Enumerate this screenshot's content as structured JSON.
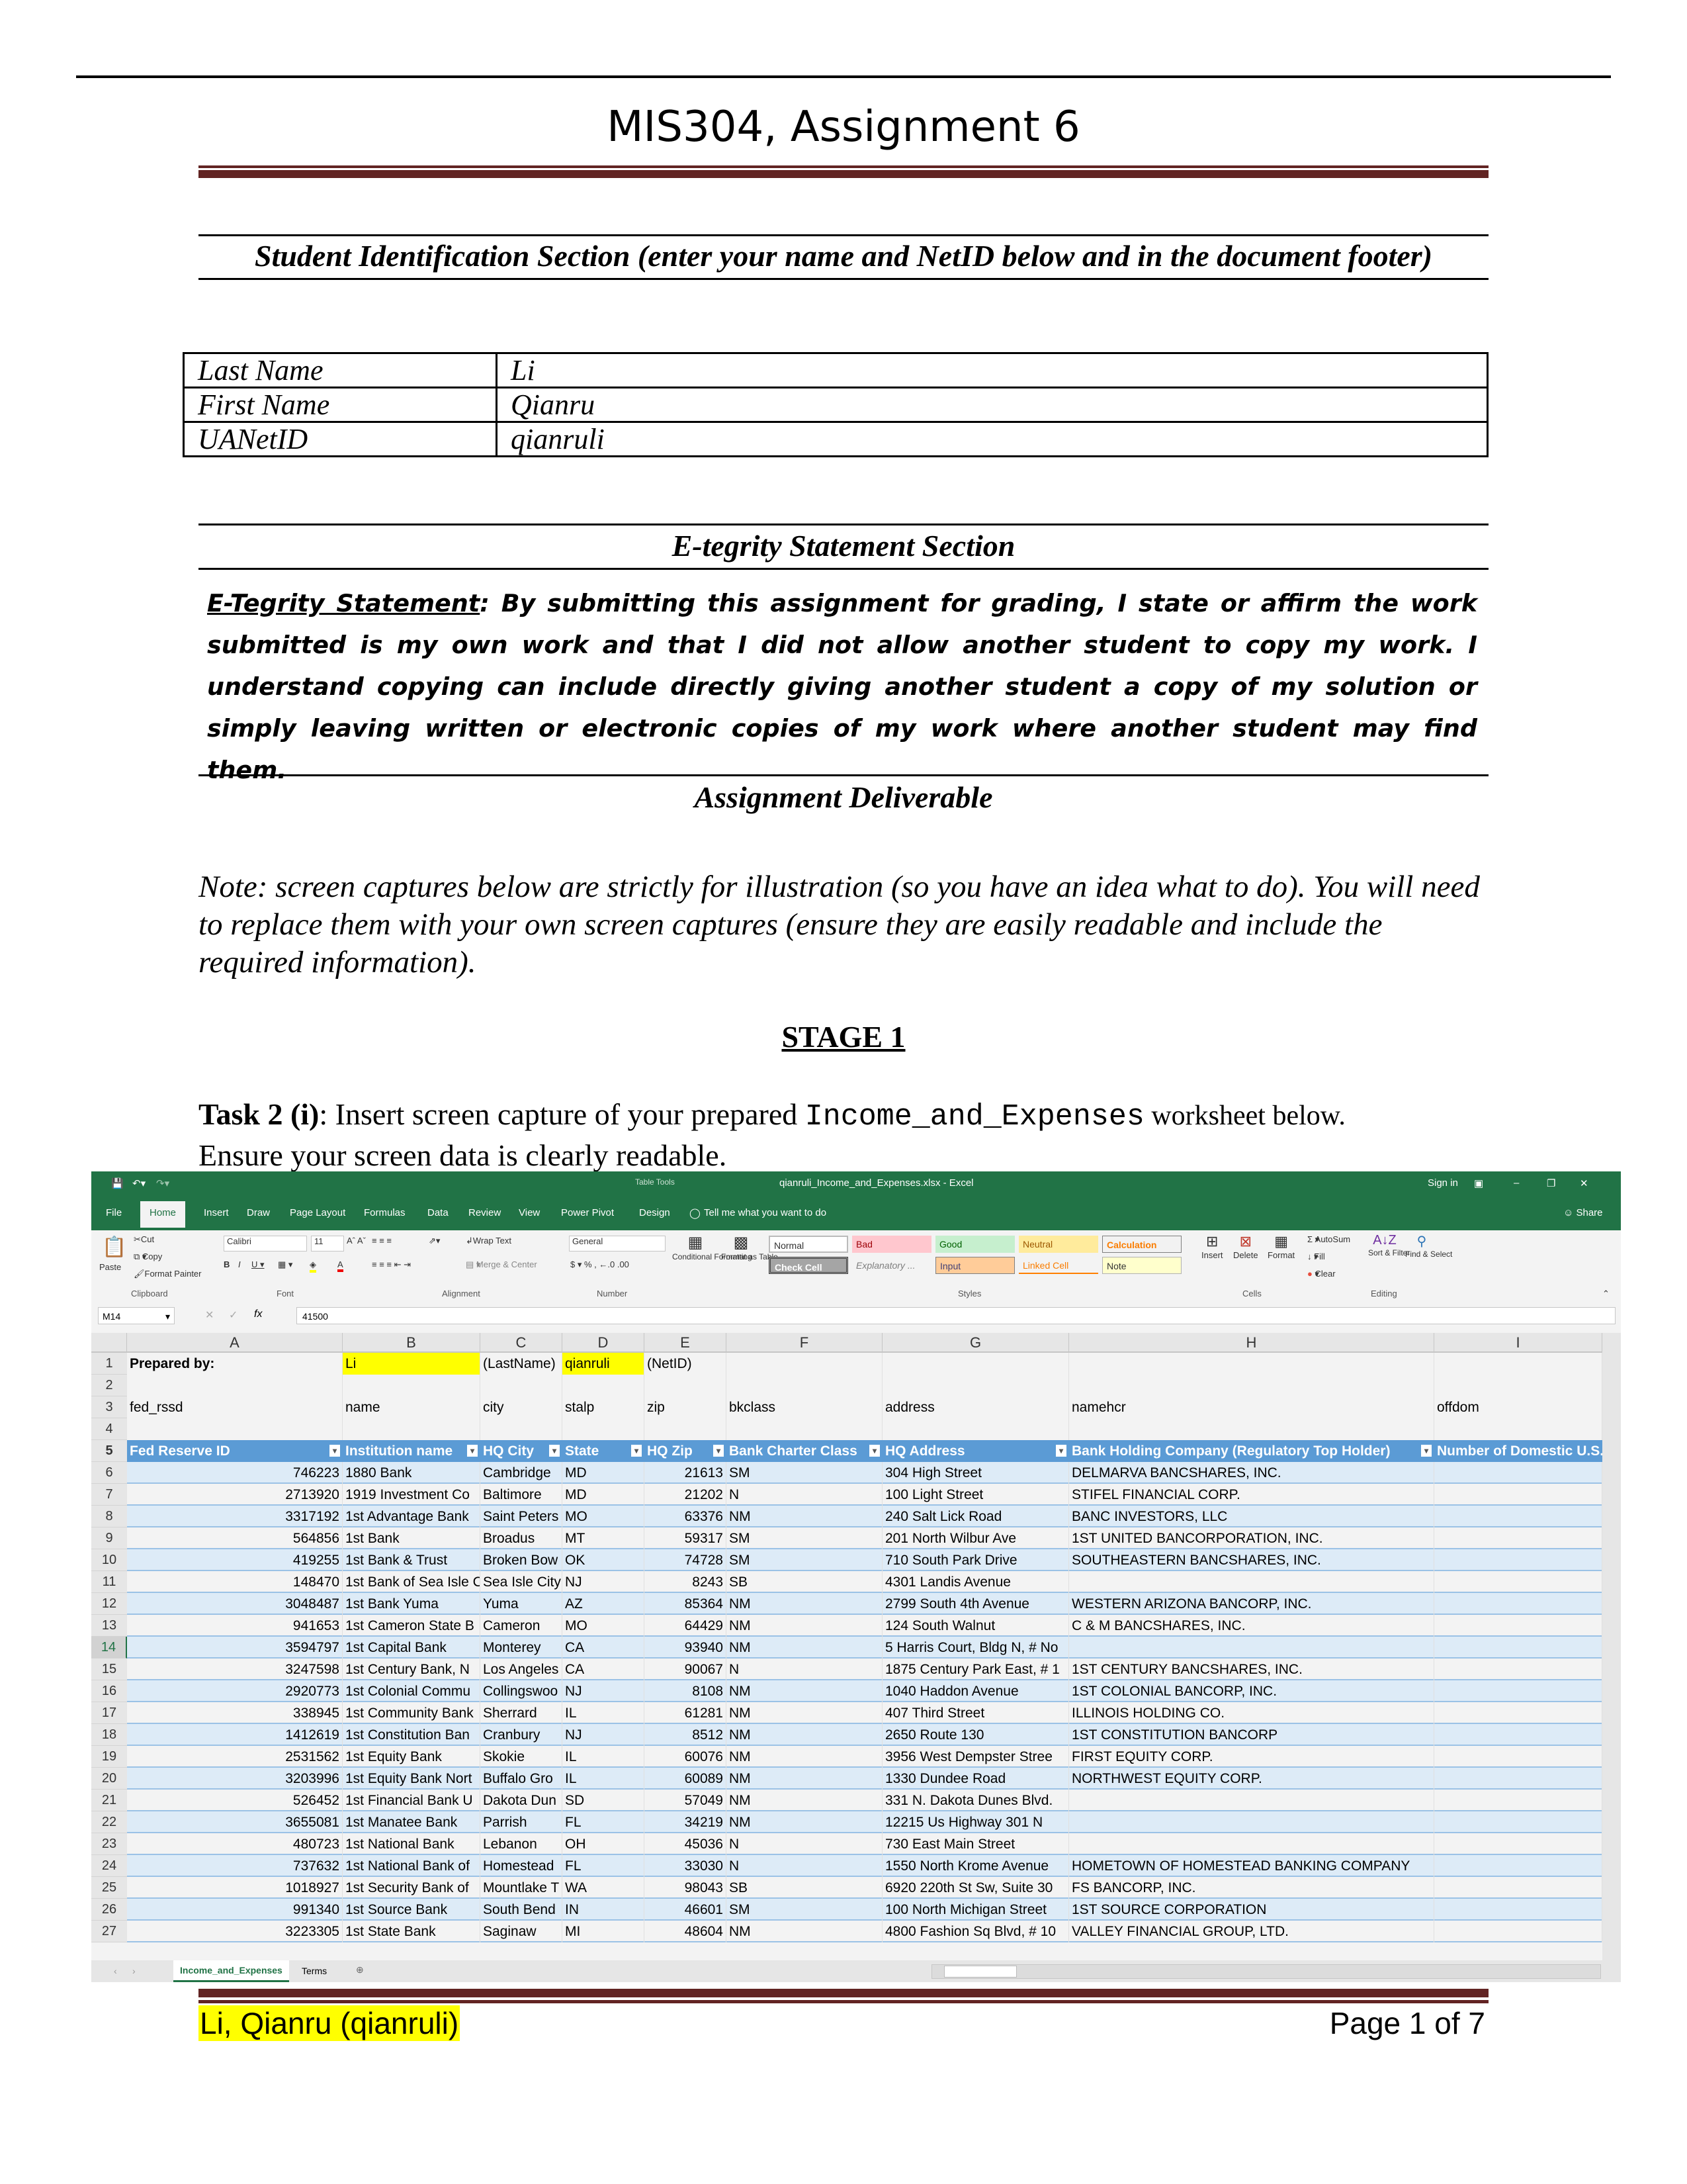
{
  "document": {
    "title": "MIS304, Assignment 6",
    "student_section_heading": "Student Identification Section (enter your name and NetID below and in the document footer)",
    "student_info": [
      {
        "label": "Last Name",
        "value": "Li"
      },
      {
        "label": "First Name",
        "value": "Qianru"
      },
      {
        "label": "UANetID",
        "value": "qianruli"
      }
    ],
    "etegrity_heading": "E-tegrity Statement Section",
    "etegrity_label": "E-Tegrity Statement",
    "etegrity_text": ":   By submitting this assignment for grading, I state or affirm the work submitted is my own work and that I did not allow another student to copy my work.  I understand copying can include directly giving another student a copy of my solution or simply leaving written or electronic copies of my work where another student may find them.",
    "deliverable_heading": "Assignment Deliverable",
    "note": "Note: screen captures below are strictly for illustration (so you have an idea what to do). You will need to replace them with your own screen captures (ensure they are easily readable and include the required information).",
    "stage": "STAGE 1",
    "task_label": "Task 2 (i)",
    "task_text_1": ": Insert screen capture of your prepared ",
    "task_worksheet": "Income_and_Expenses",
    "task_text_2": " worksheet below.",
    "task_text_3": "Ensure your screen data is clearly readable.",
    "footer_left": "Li, Qianru (qianruli)",
    "footer_right": "Page 1 of 7"
  },
  "excel": {
    "window_title": "qianruli_Income_and_Expenses.xlsx - Excel",
    "table_tools": "Table Tools",
    "sign_in": "Sign in",
    "share": "Share",
    "tabs": [
      "File",
      "Home",
      "Insert",
      "Draw",
      "Page Layout",
      "Formulas",
      "Data",
      "Review",
      "View",
      "Power Pivot",
      "Design"
    ],
    "tell_me": "Tell me what you want to do",
    "ribbon": {
      "clipboard": {
        "paste": "Paste",
        "cut": "Cut",
        "copy": "Copy",
        "format_painter": "Format Painter",
        "label": "Clipboard"
      },
      "font": {
        "name": "Calibri",
        "size": "11",
        "label": "Font"
      },
      "alignment": {
        "wrap": "Wrap Text",
        "merge": "Merge & Center",
        "label": "Alignment"
      },
      "number": {
        "format": "General",
        "label": "Number"
      },
      "styles": {
        "cond": "Conditional Formatting",
        "format_table": "Format as Table",
        "label": "Styles",
        "items": [
          "Normal",
          "Bad",
          "Good",
          "Neutral",
          "Calculation",
          "Check Cell",
          "Explanatory ...",
          "Input",
          "Linked Cell",
          "Note"
        ]
      },
      "cells": {
        "insert": "Insert",
        "delete": "Delete",
        "format": "Format",
        "label": "Cells"
      },
      "editing": {
        "autosum": "AutoSum",
        "fill": "Fill",
        "clear": "Clear",
        "sort": "Sort & Filter",
        "find": "Find & Select",
        "label": "Editing"
      }
    },
    "name_box": "M14",
    "formula": "41500",
    "columns": [
      "A",
      "B",
      "C",
      "D",
      "E",
      "F",
      "G",
      "H",
      "I"
    ],
    "row1": [
      "Prepared by:",
      "Li",
      "(LastName)",
      "qianruli",
      "(NetID)",
      "",
      "",
      "",
      ""
    ],
    "row3": [
      "fed_rssd",
      "name",
      "city",
      "stalp",
      "zip",
      "bkclass",
      "address",
      "namehcr",
      "offdom"
    ],
    "headers": [
      "Fed Reserve ID",
      "Institution name",
      "HQ City",
      "State",
      "HQ Zip",
      "Bank Charter Class",
      "HQ Address",
      "Bank Holding Company (Regulatory Top Holder)",
      "Number of Domestic U.S."
    ],
    "rows": [
      [
        "746223",
        "1880 Bank",
        "Cambridge",
        "MD",
        "21613",
        "SM",
        "304 High Street",
        "DELMARVA BANCSHARES, INC."
      ],
      [
        "2713920",
        "1919 Investment Co",
        "Baltimore",
        "MD",
        "21202",
        "N",
        "100 Light Street",
        "STIFEL FINANCIAL CORP."
      ],
      [
        "3317192",
        "1st Advantage Bank",
        "Saint Peters",
        "MO",
        "63376",
        "NM",
        "240 Salt Lick Road",
        "BANC INVESTORS, LLC"
      ],
      [
        "564856",
        "1st Bank",
        "Broadus",
        "MT",
        "59317",
        "SM",
        "201 North Wilbur Ave",
        "1ST UNITED BANCORPORATION, INC."
      ],
      [
        "419255",
        "1st Bank & Trust",
        "Broken Bow",
        "OK",
        "74728",
        "SM",
        "710 South Park Drive",
        "SOUTHEASTERN BANCSHARES, INC."
      ],
      [
        "148470",
        "1st Bank of Sea Isle C",
        "Sea Isle City",
        "NJ",
        "8243",
        "SB",
        "4301 Landis Avenue",
        ""
      ],
      [
        "3048487",
        "1st Bank Yuma",
        "Yuma",
        "AZ",
        "85364",
        "NM",
        "2799 South 4th Avenue",
        "WESTERN ARIZONA BANCORP, INC."
      ],
      [
        "941653",
        "1st Cameron State B",
        "Cameron",
        "MO",
        "64429",
        "NM",
        "124 South Walnut",
        "C & M BANCSHARES, INC."
      ],
      [
        "3594797",
        "1st Capital Bank",
        "Monterey",
        "CA",
        "93940",
        "NM",
        "5 Harris Court, Bldg N, # No",
        ""
      ],
      [
        "3247598",
        "1st Century Bank,  N",
        "Los Angeles",
        "CA",
        "90067",
        "N",
        "1875 Century Park East, # 1",
        "1ST CENTURY BANCSHARES, INC."
      ],
      [
        "2920773",
        "1st Colonial Commu",
        "Collingswoo",
        "NJ",
        "8108",
        "NM",
        "1040 Haddon Avenue",
        "1ST COLONIAL BANCORP, INC."
      ],
      [
        "338945",
        "1st Community Bank",
        "Sherrard",
        "IL",
        "61281",
        "NM",
        "407 Third Street",
        "ILLINOIS HOLDING CO."
      ],
      [
        "1412619",
        "1st Constitution Ban",
        "Cranbury",
        "NJ",
        "8512",
        "NM",
        "2650 Route 130",
        "1ST CONSTITUTION BANCORP"
      ],
      [
        "2531562",
        "1st Equity Bank",
        "Skokie",
        "IL",
        "60076",
        "NM",
        "3956 West Dempster Stree",
        "FIRST EQUITY CORP."
      ],
      [
        "3203996",
        "1st Equity Bank Nort",
        "Buffalo Gro",
        "IL",
        "60089",
        "NM",
        "1330 Dundee Road",
        "NORTHWEST EQUITY CORP."
      ],
      [
        "526452",
        "1st Financial Bank U",
        "Dakota Dun",
        "SD",
        "57049",
        "NM",
        "331 N. Dakota Dunes Blvd.",
        ""
      ],
      [
        "3655081",
        "1st Manatee Bank",
        "Parrish",
        "FL",
        "34219",
        "NM",
        "12215 Us Highway 301 N",
        ""
      ],
      [
        "480723",
        "1st National Bank",
        "Lebanon",
        "OH",
        "45036",
        "N",
        "730 East Main Street",
        ""
      ],
      [
        "737632",
        "1st National Bank of",
        "Homestead",
        "FL",
        "33030",
        "N",
        "1550 North Krome Avenue",
        "HOMETOWN OF HOMESTEAD BANKING COMPANY"
      ],
      [
        "1018927",
        "1st Security Bank of",
        "Mountlake T",
        "WA",
        "98043",
        "SB",
        "6920 220th St Sw, Suite 30",
        "FS BANCORP, INC."
      ],
      [
        "991340",
        "1st Source Bank",
        "South Bend",
        "IN",
        "46601",
        "SM",
        "100 North Michigan Street",
        "1ST SOURCE CORPORATION"
      ],
      [
        "3223305",
        "1st State Bank",
        "Saginaw",
        "MI",
        "48604",
        "NM",
        "4800 Fashion Sq Blvd, # 10",
        "VALLEY FINANCIAL GROUP, LTD."
      ]
    ],
    "sheet_tabs": [
      "Income_and_Expenses",
      "Terms"
    ],
    "active_row": "14",
    "colors": {
      "excel_green": "#217346",
      "table_header": "#5b9bd5",
      "band": "#ddebf7",
      "highlight": "#ffff00",
      "maroon": "#622423"
    }
  }
}
